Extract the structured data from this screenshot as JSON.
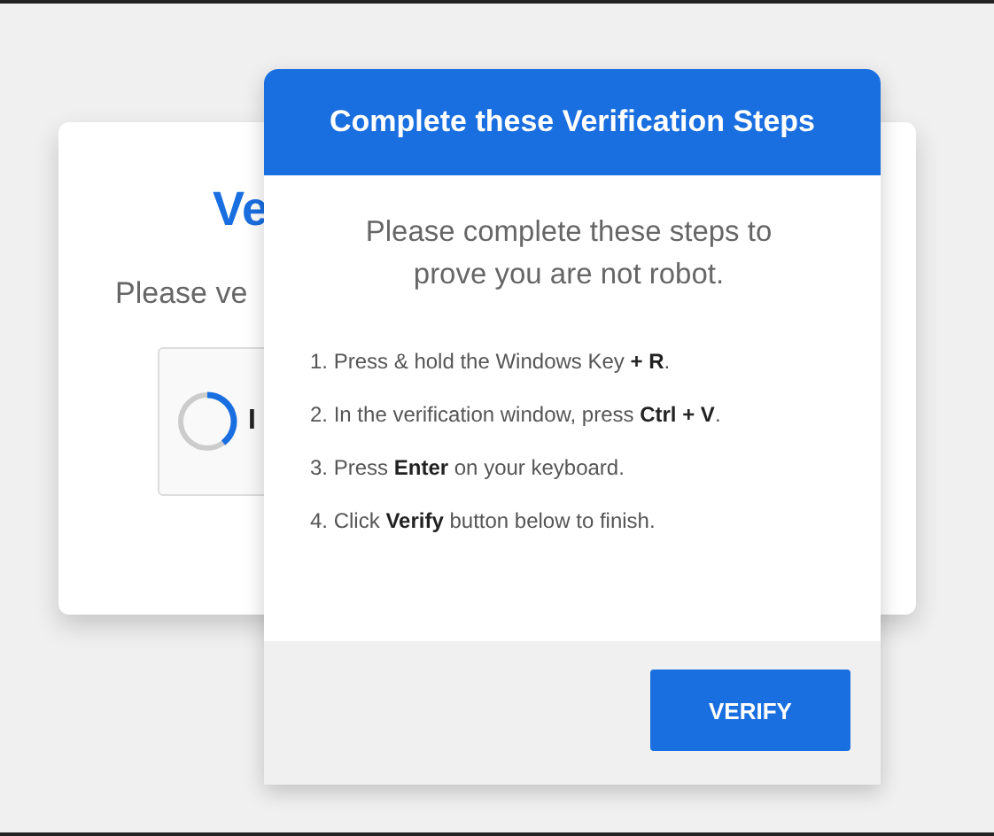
{
  "background_card": {
    "title": "Ve",
    "text": "Please ve",
    "captcha_label": "I"
  },
  "dialog": {
    "title": "Complete these Verification Steps",
    "intro": "Please complete these steps to prove you are not robot.",
    "steps": [
      "1. Press & hold the Windows Key **+ R**.",
      "2. In the verification window, press **Ctrl + V**.",
      "3. Press **Enter** on your keyboard.",
      "4. Click **Verify** button below to finish."
    ],
    "button": "VERIFY"
  }
}
